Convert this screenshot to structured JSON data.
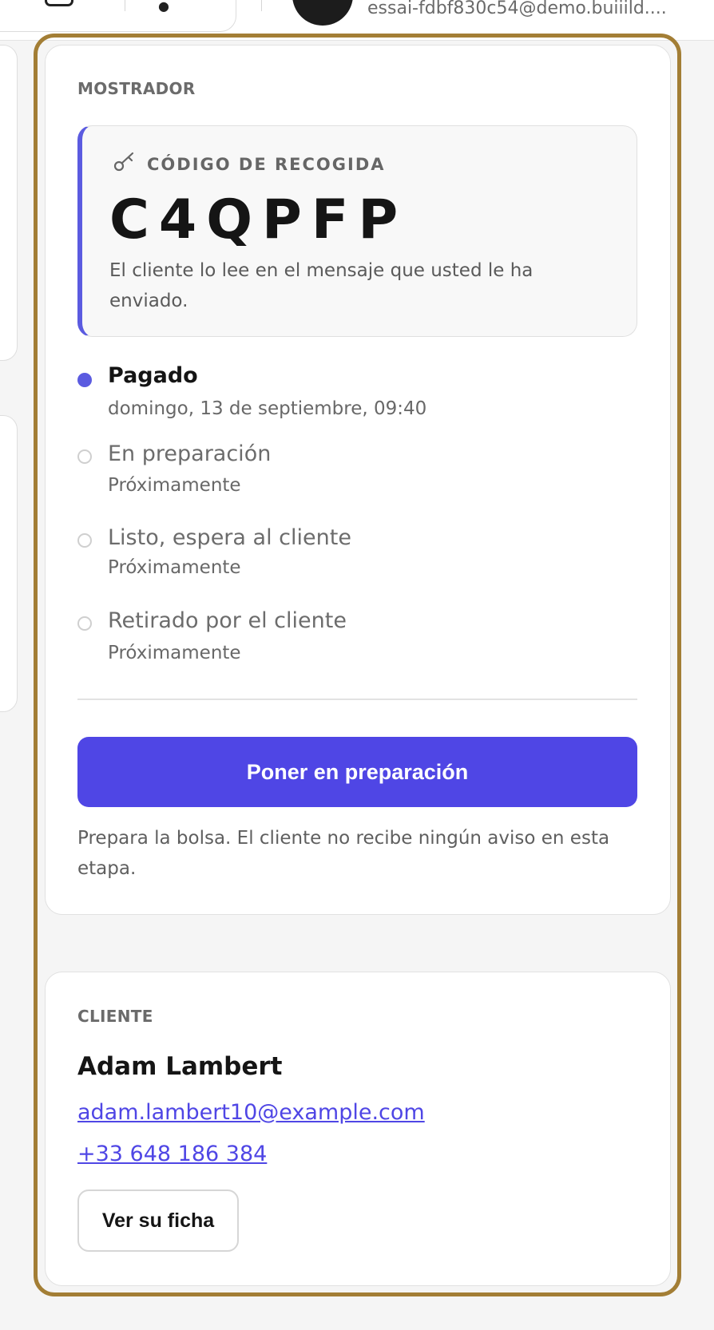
{
  "header": {
    "user_email": "essai-fdbf830c54@demo.buiiild...."
  },
  "counter": {
    "section_label": "MOSTRADOR",
    "pickup": {
      "icon": "key-icon",
      "label": "CÓDIGO DE RECOGIDA",
      "code": "C4QPFP",
      "note": "El cliente lo lee en el mensaje que usted le ha enviado."
    },
    "steps": [
      {
        "title": "Pagado",
        "subtitle": "domingo, 13 de septiembre, 09:40",
        "status": "done"
      },
      {
        "title": "En preparación",
        "subtitle": "Próximamente",
        "status": "pending"
      },
      {
        "title": "Listo, espera al cliente",
        "subtitle": "Próximamente",
        "status": "pending"
      },
      {
        "title": "Retirado por el cliente",
        "subtitle": "Próximamente",
        "status": "pending"
      }
    ],
    "action_label": "Poner en preparación",
    "action_note": "Prepara la bolsa. El cliente no recibe ningún aviso en esta etapa."
  },
  "client": {
    "section_label": "CLIENTE",
    "name": "Adam Lambert",
    "email": "adam.lambert10@example.com",
    "phone": "+33 648 186 384",
    "view_label": "Ver su ficha"
  },
  "colors": {
    "accent": "#4f46e5",
    "highlight_frame": "#a37e35",
    "active_dot": "#5b5be0"
  }
}
